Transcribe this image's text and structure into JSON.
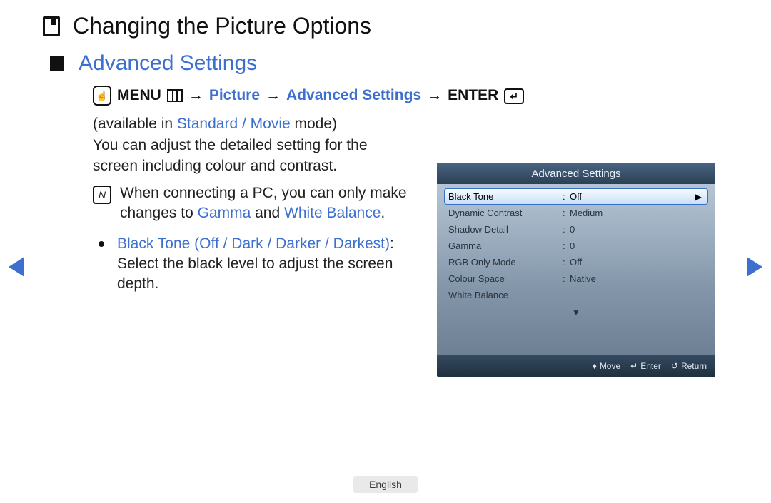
{
  "title": "Changing the Picture Options",
  "subtitle": "Advanced Settings",
  "nav_path": {
    "menu_label": "MENU",
    "arrow": "→",
    "picture": "Picture",
    "advanced": "Advanced Settings",
    "enter_label": "ENTER"
  },
  "body": {
    "available_prefix": "(available in ",
    "available_modes": "Standard / Movie",
    "available_suffix": " mode)",
    "desc": "You can adjust the detailed setting for the screen including colour and contrast.",
    "note_prefix": "When connecting a PC, you can only make changes to ",
    "note_gamma": "Gamma",
    "note_and": " and ",
    "note_wb": "White Balance",
    "note_period": ".",
    "bullet_title": "Black Tone (Off / Dark / Darker / Darkest)",
    "bullet_body_prefix": ": ",
    "bullet_body": "Select the black level to adjust the screen depth."
  },
  "osd": {
    "title": "Advanced Settings",
    "rows": [
      {
        "label": "Black Tone",
        "value": "Off",
        "selected": true
      },
      {
        "label": "Dynamic Contrast",
        "value": "Medium"
      },
      {
        "label": "Shadow Detail",
        "value": "0"
      },
      {
        "label": "Gamma",
        "value": "0"
      },
      {
        "label": "RGB Only Mode",
        "value": "Off"
      },
      {
        "label": "Colour Space",
        "value": "Native"
      },
      {
        "label": "White Balance",
        "value": ""
      }
    ],
    "more_indicator": "▼",
    "footer": {
      "move": "Move",
      "enter": "Enter",
      "return": "Return"
    }
  },
  "language": "English"
}
